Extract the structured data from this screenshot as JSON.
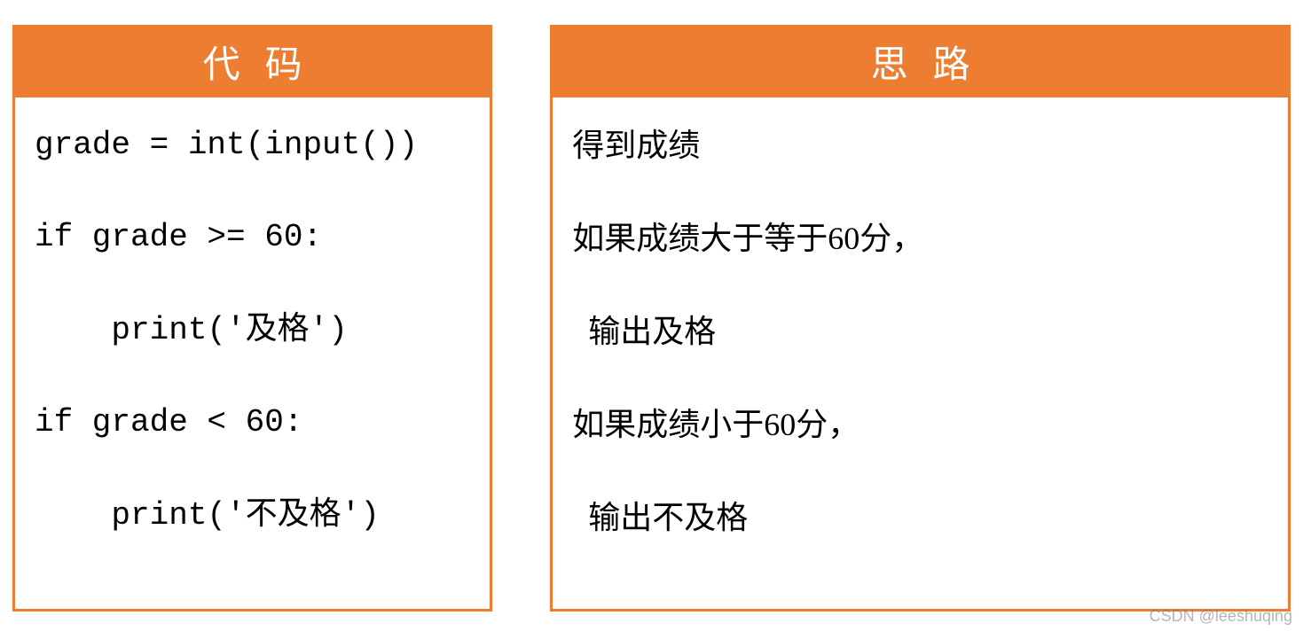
{
  "left": {
    "title": "代码",
    "code": "grade = int(input())\n\nif grade >= 60:\n\n    print('及格')\n\nif grade < 60:\n\n    print('不及格')"
  },
  "right": {
    "title": "思路",
    "lines": "得到成绩\n\n如果成绩大于等于60分，\n\n  输出及格\n\n如果成绩小于60分，\n\n  输出不及格"
  },
  "watermark": "CSDN @leeshuqing"
}
